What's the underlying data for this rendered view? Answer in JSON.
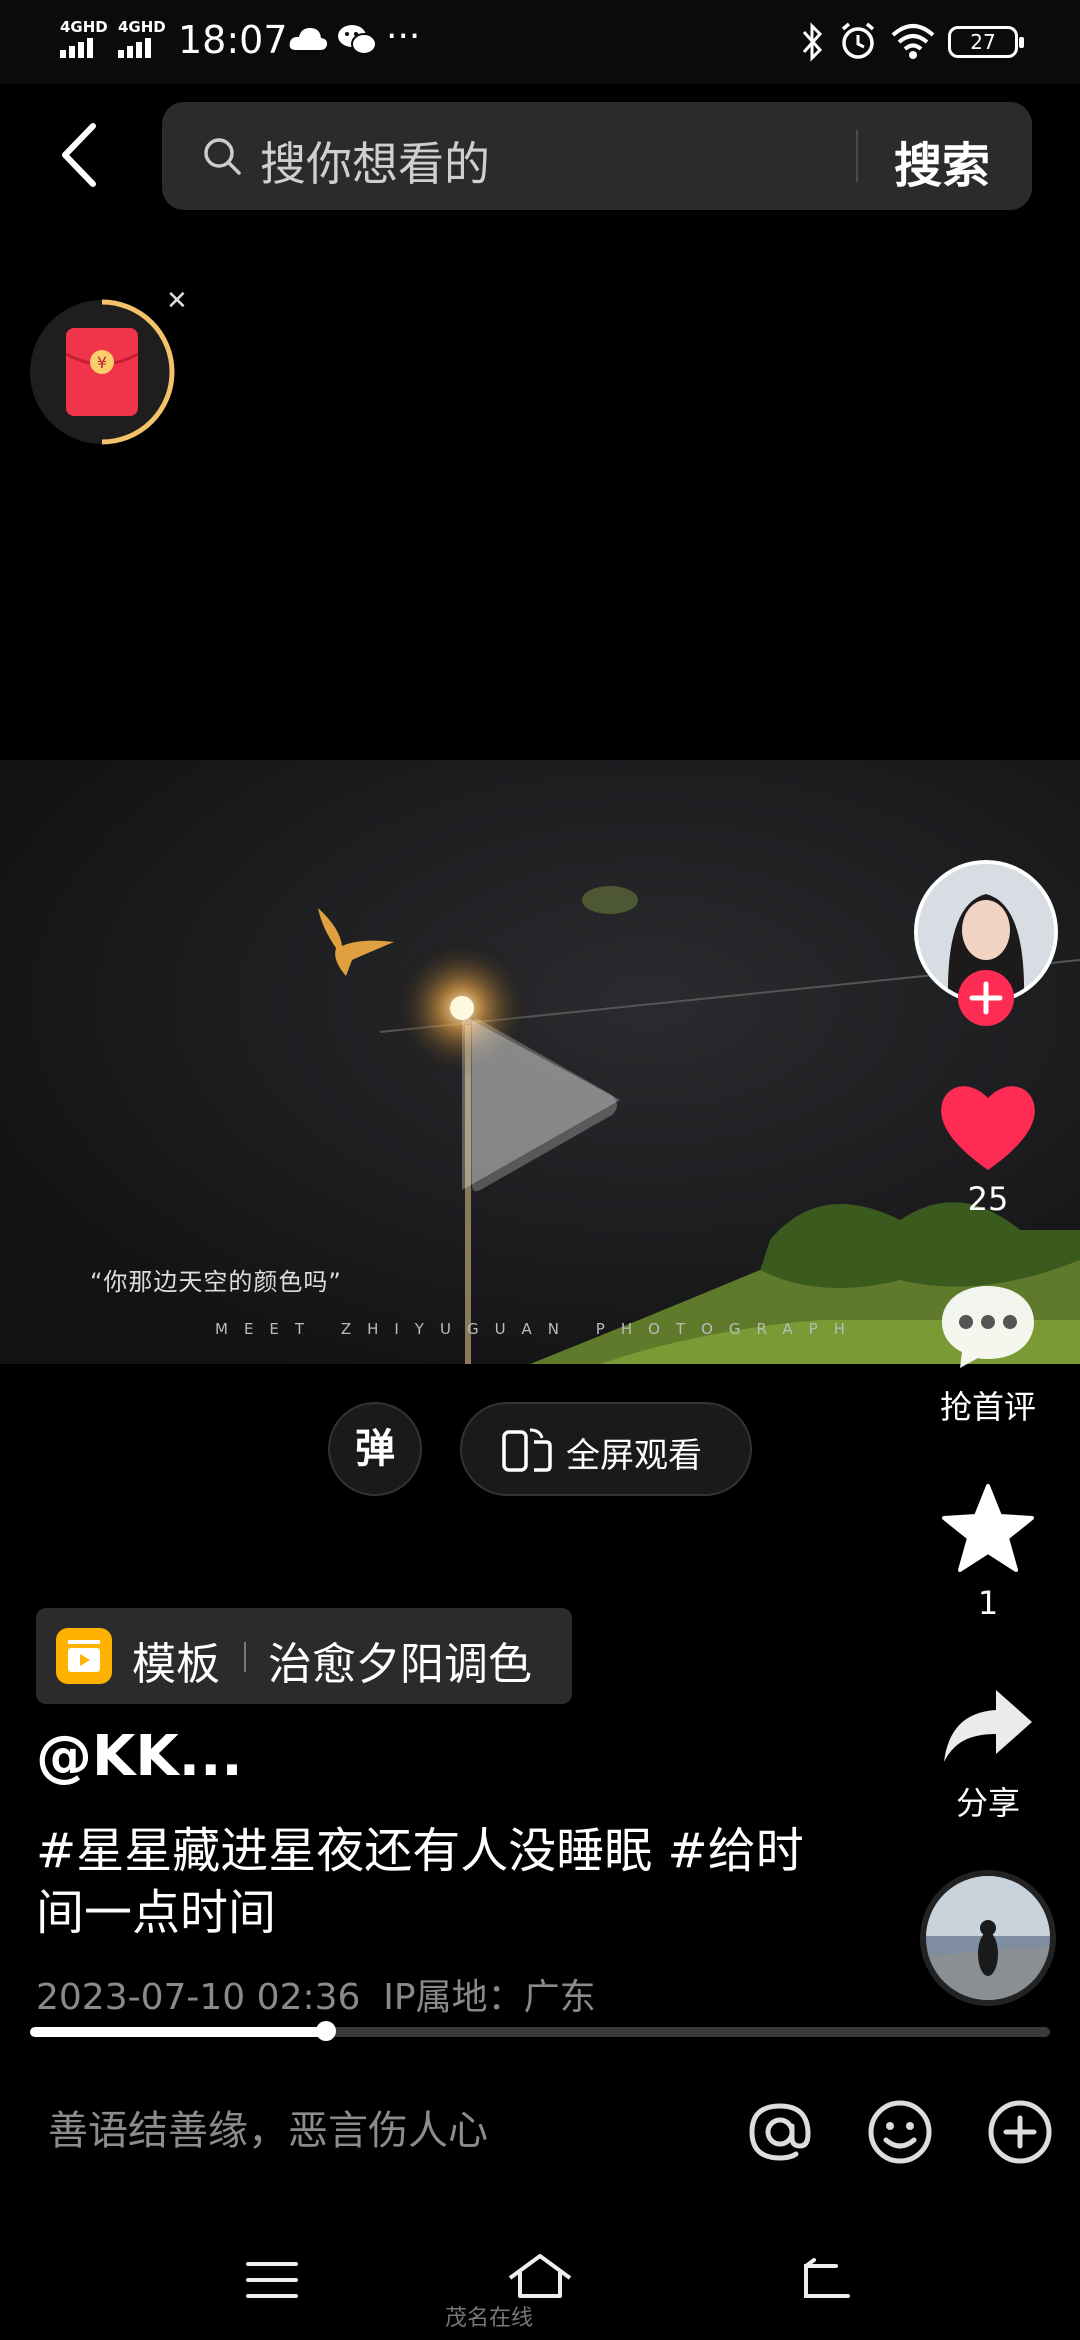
{
  "status_bar": {
    "net1": "4GHD",
    "net2": "4GHD",
    "time": "18:07",
    "more": "···",
    "battery": "27"
  },
  "search": {
    "placeholder": "搜你想看的",
    "button": "搜索"
  },
  "video": {
    "caption": "“你那边天空的颜色吗”",
    "watermark": "MEET ZHIYUGUAN PHOTOGRAPH"
  },
  "rail": {
    "likes": "25",
    "comments": "抢首评",
    "favorites": "1",
    "share": "分享"
  },
  "controls": {
    "danmu": "弹",
    "fullscreen": "全屏观看"
  },
  "template_tag": {
    "label": "模板",
    "name": "治愈夕阳调色"
  },
  "post": {
    "author": "@KK...",
    "description": "#星星藏进星夜还有人没睡眠 #给时间一点时间",
    "date": "2023-07-10 02:36",
    "location": "IP属地：广东"
  },
  "progress": {
    "fraction": 0.29
  },
  "comment": {
    "placeholder": "善语结善缘，恶言伤人心"
  },
  "site_watermark": "茂名在线",
  "colors": {
    "accent": "#fe2c55",
    "like": "#fe2c55",
    "template_icon": "#ffb300"
  }
}
